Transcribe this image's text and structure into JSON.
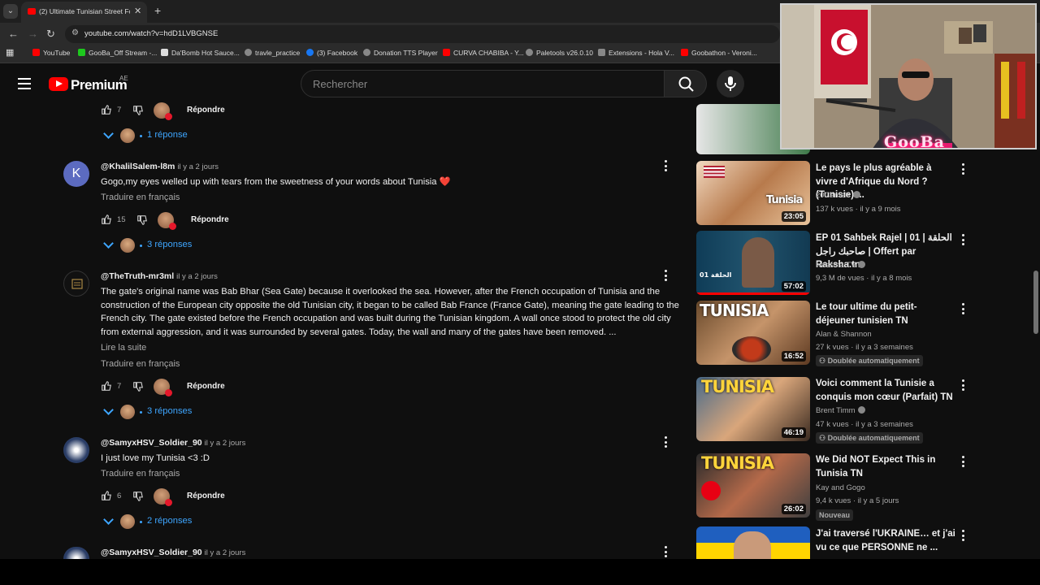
{
  "browser": {
    "tab_title": "(2) Ultimate Tunisian Street Foo",
    "url": "youtube.com/watch?v=hdD1LVBGNSE",
    "bookmarks": [
      {
        "label": "YouTube",
        "color": "#ff0000"
      },
      {
        "label": "GooBa_Off Stream -...",
        "color": "#1ec81e"
      },
      {
        "label": "Da'Bomb Hot Sauce...",
        "color": "#dddddd"
      },
      {
        "label": "travle_practice",
        "color": "#aaaaaa"
      },
      {
        "label": "(3) Facebook",
        "color": "#1877f2"
      },
      {
        "label": "Donation TTS Player",
        "color": "#aaaaaa"
      },
      {
        "label": "CURVA CHABIBA - Y...",
        "color": "#ff0000"
      },
      {
        "label": "Paletools v26.0.10",
        "color": "#aaaaaa"
      },
      {
        "label": "Extensions - Hola V...",
        "color": "#aaaaaa"
      },
      {
        "label": "Goobathon - Veroni...",
        "color": "#ff0000"
      }
    ]
  },
  "youtube": {
    "logo_text": "Premium",
    "country": "AE",
    "search_placeholder": "Rechercher"
  },
  "comments": [
    {
      "likes": "7",
      "reply_label": "Répondre",
      "replies_label": "1 réponse"
    },
    {
      "handle": "@KhalilSalem-l8m",
      "when": "il y a 2 jours",
      "avatar_letter": "K",
      "text": "Gogo,my eyes welled up with tears from the sweetness of your words about Tunisia ❤️",
      "translate": "Traduire en français",
      "likes": "15",
      "reply_label": "Répondre",
      "replies_label": "3 réponses"
    },
    {
      "handle": "@TheTruth-mr3ml",
      "when": "il y a 2 jours",
      "text": "The gate's original name was Bab Bhar (Sea Gate) because it overlooked the sea. However, after the French occupation of Tunisia and the construction of the European city opposite the old Tunisian city, it began to be called Bab France (France Gate), meaning the gate leading to the French city. The gate existed before the French occupation and was built during the Tunisian kingdom. A wall once stood to protect the old city from external aggression, and it was surrounded by several gates. Today, the wall and many of the gates have been removed. ...",
      "read_more": "Lire la suite",
      "translate": "Traduire en français",
      "likes": "7",
      "reply_label": "Répondre",
      "replies_label": "3 réponses"
    },
    {
      "handle": "@SamyxHSV_Soldier_90",
      "when": "il y a 2 jours",
      "text": "I just love my Tunisia <3 :D",
      "translate": "Traduire en français",
      "likes": "6",
      "reply_label": "Répondre",
      "replies_label": "2 réponses"
    },
    {
      "handle": "@SamyxHSV_Soldier_90",
      "when": "il y a 2 jours"
    }
  ],
  "videos": [
    {
      "title": "Le pays le plus agréable à vivre d'Afrique du Nord ? (Tunisie) ...",
      "channel": "20Camels",
      "meta": "137 k vues · il y a 9 mois",
      "duration": "23:05",
      "thumb_text": "Tunisia"
    },
    {
      "title": "EP 01 Sahbek Rajel | 01 الحلقة | صاحبك راجل | Offert par Raksha.tn",
      "channel": "Nessma TV",
      "meta": "9,3 M de vues · il y a 8 mois",
      "duration": "57:02",
      "thumb_text": "01 الحلقة"
    },
    {
      "title": "Le tour ultime du petit-déjeuner tunisien TN",
      "channel": "Alan & Shannon",
      "meta": "27 k vues · il y a 3 semaines",
      "badge": "Doublée automatiquement",
      "duration": "16:52",
      "thumb_text": "TUNISIA"
    },
    {
      "title": "Voici comment la Tunisie a conquis mon cœur (Parfait) TN",
      "channel": "Brent Timm",
      "meta": "47 k vues · il y a 3 semaines",
      "badge": "Doublée automatiquement",
      "duration": "46:19",
      "thumb_text": "TUNISIA"
    },
    {
      "title": "We Did NOT Expect This in Tunisia TN",
      "channel": "Kay and Gogo",
      "meta": "9,4 k vues · il y a 5 jours",
      "badge": "Nouveau",
      "duration": "26:02",
      "thumb_text": "TUNISIA"
    },
    {
      "title": "J'ai traversé l'UKRAINE… et j'ai vu ce que PERSONNE ne ..."
    }
  ],
  "webcam": {
    "overlay_text": "GooBa"
  }
}
